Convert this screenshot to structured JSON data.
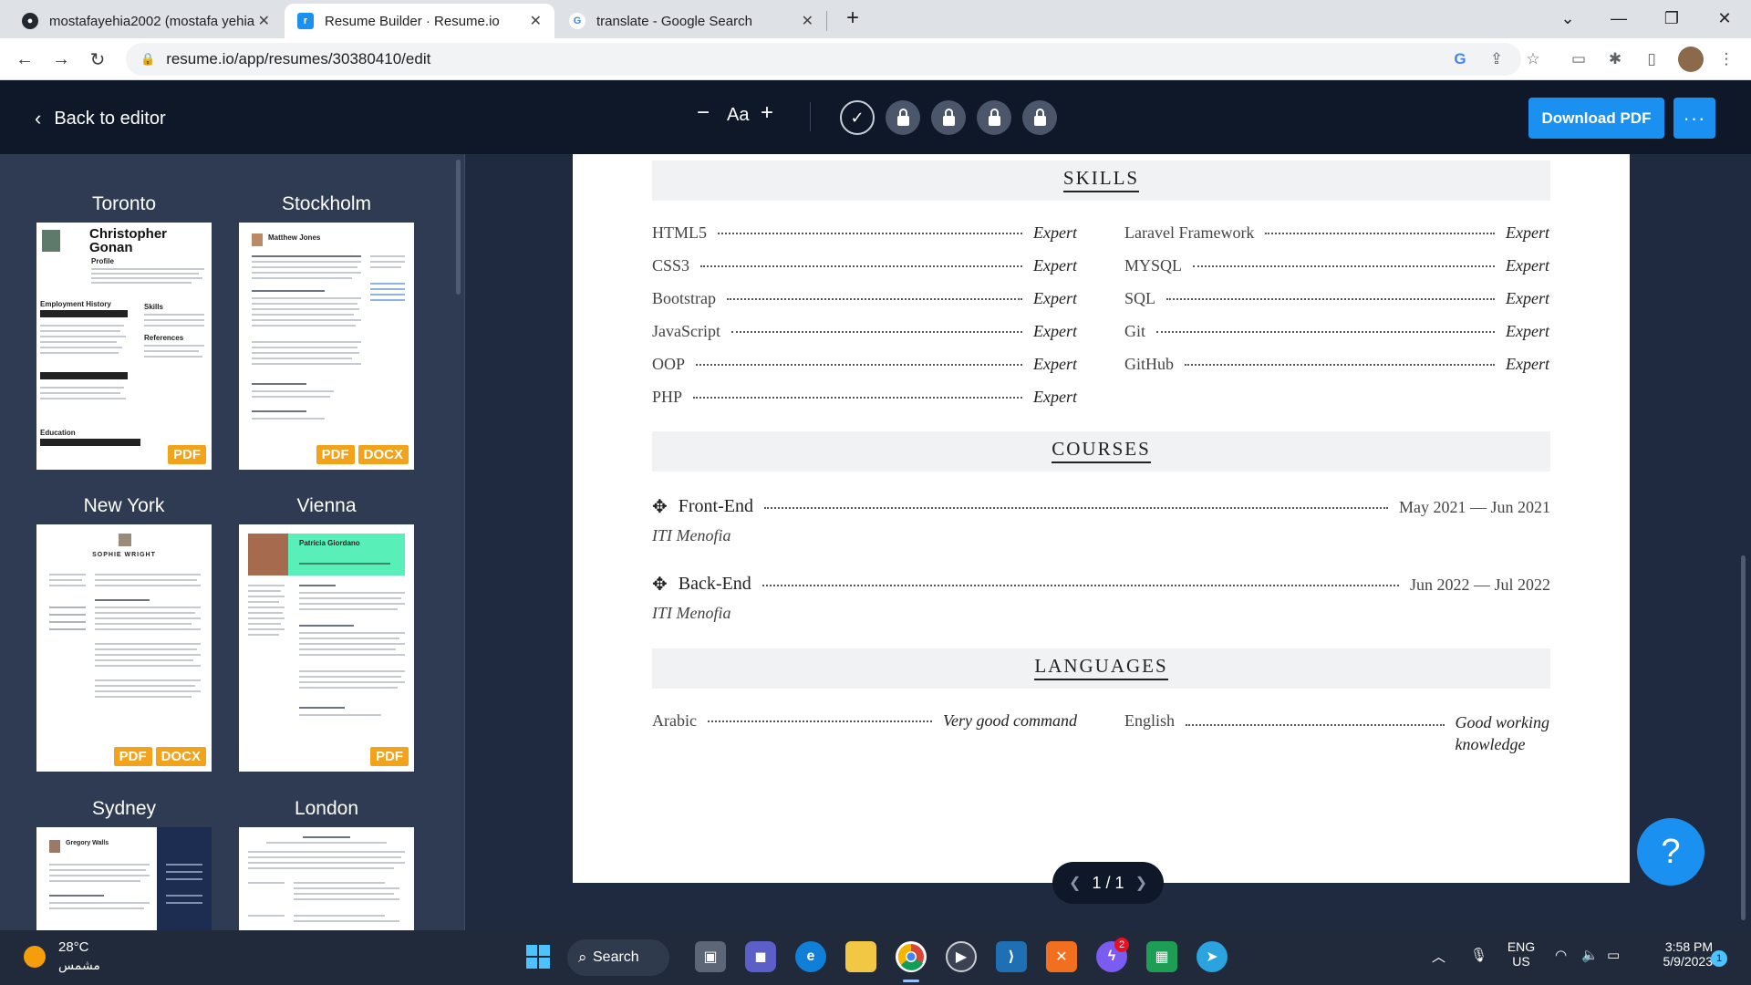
{
  "browser": {
    "tabs": [
      {
        "title": "mostafayehia2002 (mostafa yehia",
        "icon": "github-icon",
        "active": false
      },
      {
        "title": "Resume Builder · Resume.io",
        "icon": "resume-io-icon",
        "active": true
      },
      {
        "title": "translate - Google Search",
        "icon": "google-icon",
        "active": false
      }
    ],
    "url": "resume.io/app/resumes/30380410/edit"
  },
  "app": {
    "back_label": "Back to editor",
    "font_size_label": "Aa",
    "download_label": "Download PDF",
    "more_label": "···"
  },
  "templates": [
    {
      "name": "Toronto",
      "badges": [
        "PDF"
      ]
    },
    {
      "name": "Stockholm",
      "badges": [
        "PDF",
        "DOCX"
      ]
    },
    {
      "name": "New York",
      "badges": [
        "PDF",
        "DOCX"
      ]
    },
    {
      "name": "Vienna",
      "badges": [
        "PDF"
      ]
    },
    {
      "name": "Sydney",
      "badges": []
    },
    {
      "name": "London",
      "badges": []
    }
  ],
  "template_previews": {
    "toronto_name": "Christopher Gonan",
    "toronto_profile": "Profile",
    "toronto_employment": "Employment History",
    "toronto_skills": "Skills",
    "toronto_references": "References",
    "toronto_education": "Education",
    "stockholm_name": "Matthew Jones",
    "newyork_name": "SOPHIE WRIGHT",
    "vienna_name": "Patricia Giordano",
    "sydney_name": "Gregory Walls"
  },
  "resume": {
    "skills_title": "SKILLS",
    "skills": [
      {
        "name": "HTML5",
        "level": "Expert"
      },
      {
        "name": "Laravel Framework",
        "level": "Expert"
      },
      {
        "name": "CSS3",
        "level": "Expert"
      },
      {
        "name": "MYSQL",
        "level": "Expert"
      },
      {
        "name": "Bootstrap",
        "level": "Expert"
      },
      {
        "name": "SQL",
        "level": "Expert"
      },
      {
        "name": "JavaScript",
        "level": "Expert"
      },
      {
        "name": "Git",
        "level": "Expert"
      },
      {
        "name": "OOP",
        "level": "Expert"
      },
      {
        "name": "GitHub",
        "level": "Expert"
      },
      {
        "name": "PHP",
        "level": "Expert"
      }
    ],
    "courses_title": "COURSES",
    "courses": [
      {
        "title": "Front-End",
        "dates": "May 2021 — Jun 2021",
        "institution": "ITI Menofia"
      },
      {
        "title": "Back-End",
        "dates": "Jun 2022 — Jul 2022",
        "institution": "ITI Menofia"
      }
    ],
    "languages_title": "LANGUAGES",
    "languages": [
      {
        "name": "Arabic",
        "level": "Very good command"
      },
      {
        "name": "English",
        "level_line1": "Good working",
        "level_line2": "knowledge"
      }
    ]
  },
  "pager": {
    "label": "1 / 1"
  },
  "help_label": "?",
  "taskbar": {
    "weather_temp": "28°C",
    "weather_desc": "مشمس",
    "search_label": "Search",
    "lang_line1": "ENG",
    "lang_line2": "US",
    "time": "3:58 PM",
    "date": "5/9/2023",
    "messenger_badge": "2",
    "notif_badge": "1"
  }
}
